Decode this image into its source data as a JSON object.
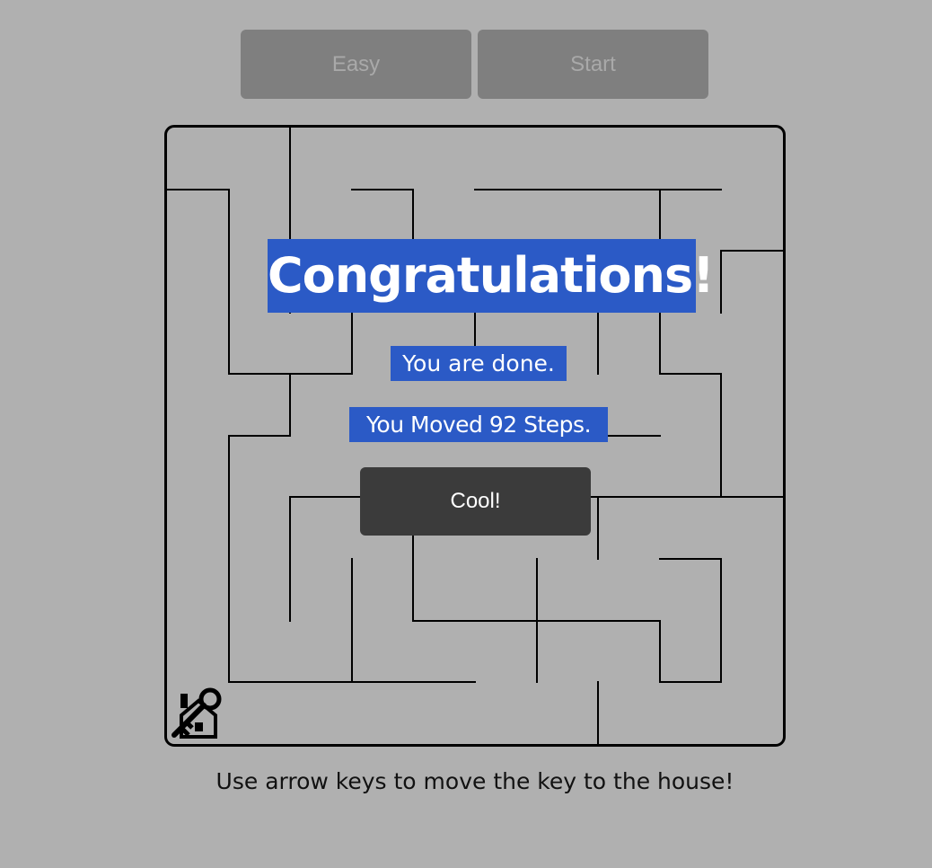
{
  "controls": {
    "difficulty_label": "Easy",
    "start_label": "Start"
  },
  "maze": {
    "cols": 10,
    "rows": 10,
    "wall_color": "#000000",
    "background": "#b0b0b0",
    "marker_icon": "key-on-house-icon"
  },
  "message": {
    "title": "Congratulations!",
    "line1": "You are done.",
    "line2": "You Moved 92 Steps.",
    "button_label": "Cool!"
  },
  "footer": {
    "instructions": "Use arrow keys to move the key to the house!"
  },
  "colors": {
    "highlight": "#2b5ac6",
    "button_dark": "#3b3b3b",
    "button_gray": "#7f7f7f"
  }
}
